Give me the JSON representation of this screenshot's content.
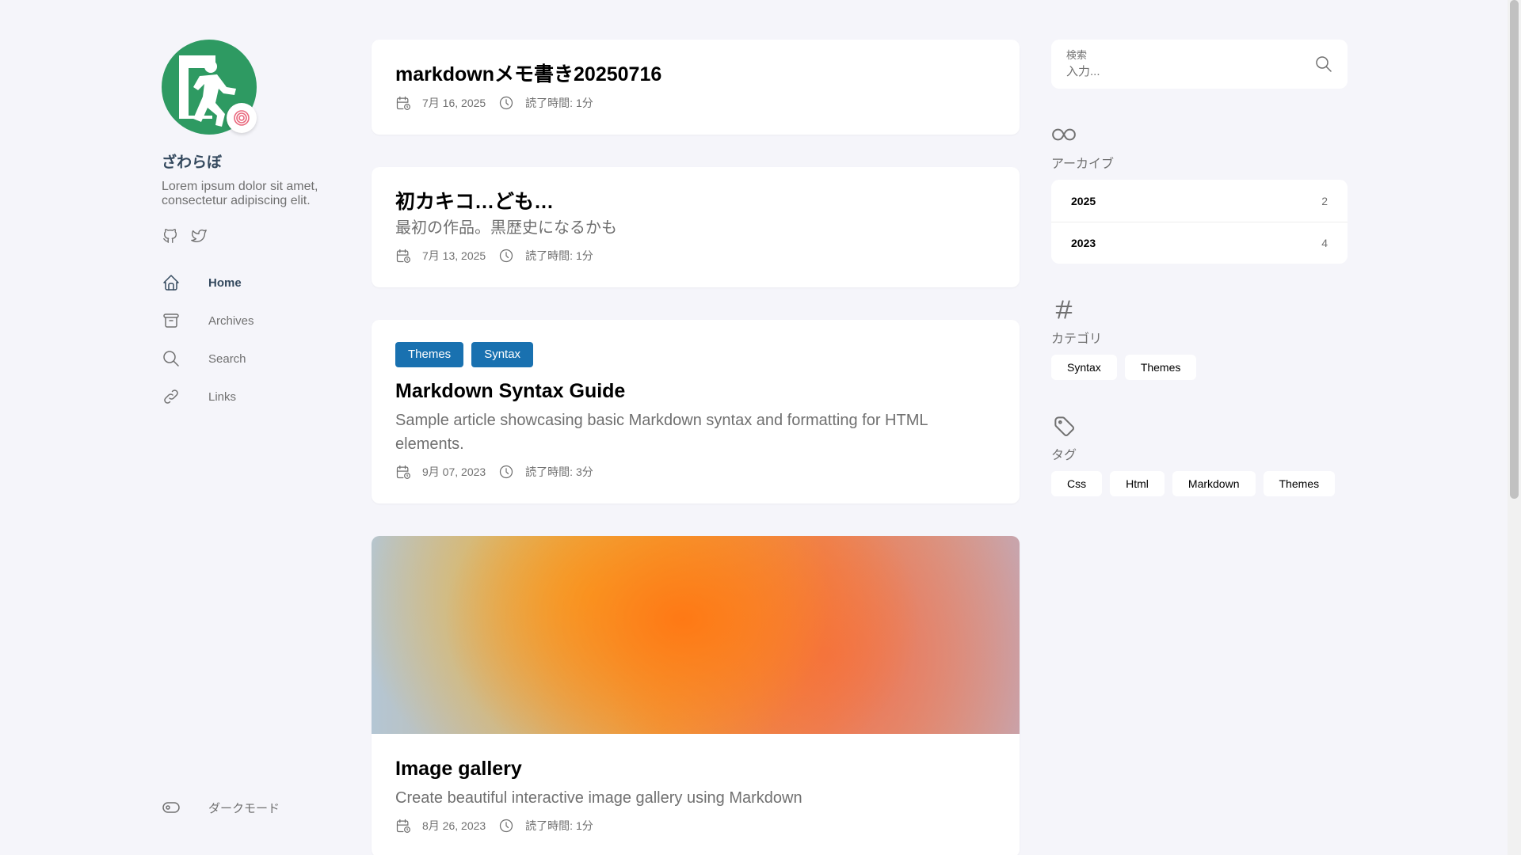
{
  "sidebar": {
    "site_name": "ざわらぼ",
    "description": "Lorem ipsum dolor sit amet, consectetur adipiscing elit.",
    "menu": [
      {
        "label": "Home",
        "icon": "home-icon",
        "active": true
      },
      {
        "label": "Archives",
        "icon": "archive-icon"
      },
      {
        "label": "Search",
        "icon": "search-icon"
      },
      {
        "label": "Links",
        "icon": "link-icon"
      }
    ],
    "dark_mode_label": "ダークモード"
  },
  "posts": [
    {
      "title": "markdownメモ書き20250716",
      "date": "7月 16, 2025",
      "reading_time": "読了時間: 1分"
    },
    {
      "title": "初カキコ…ども…",
      "subtitle": "最初の作品。黒歴史になるかも",
      "date": "7月 13, 2025",
      "reading_time": "読了時間: 1分"
    },
    {
      "tags": [
        "Themes",
        "Syntax"
      ],
      "title": "Markdown Syntax Guide",
      "subtitle": "Sample article showcasing basic Markdown syntax and formatting for HTML elements.",
      "date": "9月 07, 2023",
      "reading_time": "読了時間: 3分"
    },
    {
      "title": "Image gallery",
      "subtitle": "Create beautiful interactive image gallery using Markdown",
      "date": "8月 26, 2023",
      "reading_time": "読了時間: 1分"
    }
  ],
  "search": {
    "label": "検索",
    "placeholder": "入力..."
  },
  "archives": {
    "title": "アーカイブ",
    "rows": [
      {
        "year": "2025",
        "count": "2"
      },
      {
        "year": "2023",
        "count": "4"
      }
    ]
  },
  "categories": {
    "title": "カテゴリ",
    "items": [
      "Syntax",
      "Themes"
    ]
  },
  "tags_widget": {
    "title": "タグ",
    "items": [
      "Css",
      "Html",
      "Markdown",
      "Themes"
    ]
  },
  "colors": {
    "background": "#f5f5fa",
    "accent": "#1971b0",
    "avatar_green": "#2e9a62",
    "site_name": "#34495e"
  }
}
